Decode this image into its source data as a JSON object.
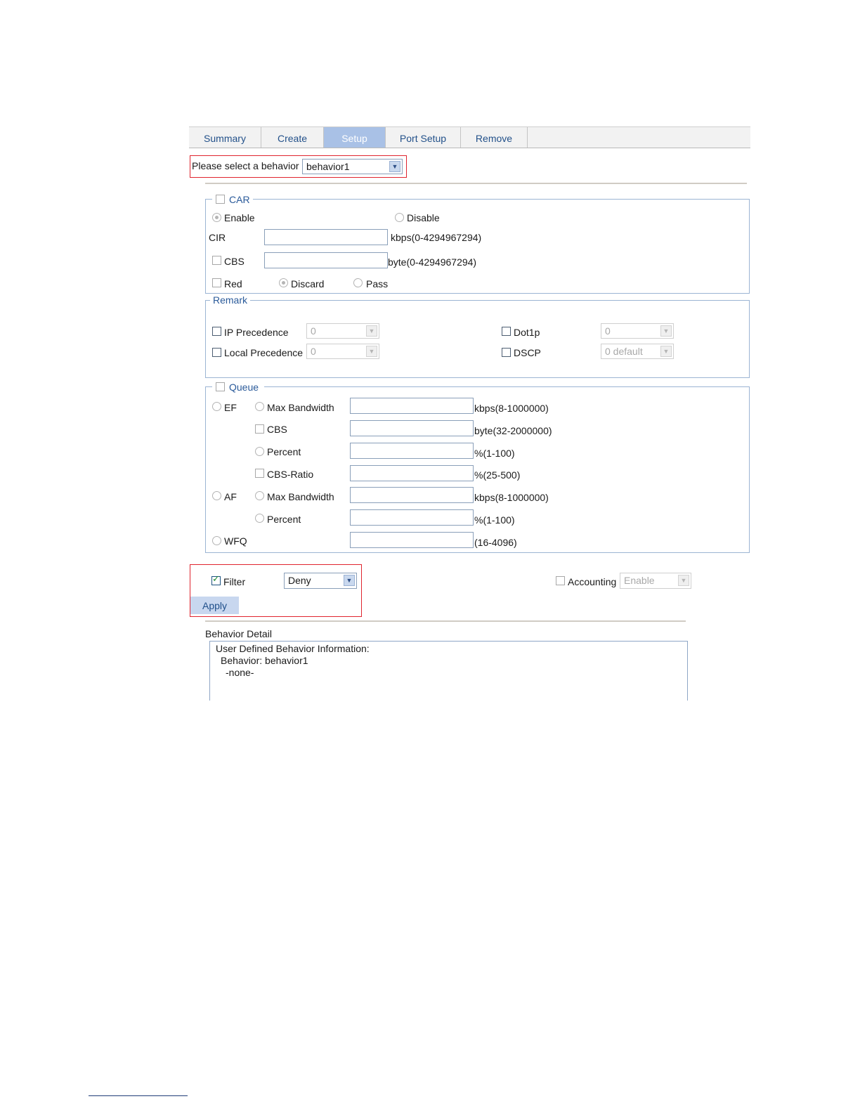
{
  "tabs": [
    {
      "label": "Summary"
    },
    {
      "label": "Create"
    },
    {
      "label": "Setup"
    },
    {
      "label": "Port Setup"
    },
    {
      "label": "Remove"
    }
  ],
  "behavior_select": {
    "label": "Please select a behavior",
    "value": "behavior1"
  },
  "car": {
    "legend": "CAR",
    "enable": "Enable",
    "disable": "Disable",
    "cir_label": "CIR",
    "cir_value": "",
    "cir_range": "kbps(0-4294967294)",
    "cbs_label": "CBS",
    "cbs_value": "",
    "cbs_range": "byte(0-4294967294)",
    "red_label": "Red",
    "discard": "Discard",
    "pass": "Pass"
  },
  "remark": {
    "legend": "Remark",
    "ip_precedence": {
      "label": "IP Precedence",
      "value": "0"
    },
    "local_precedence": {
      "label": "Local Precedence",
      "value": "0"
    },
    "dot1p": {
      "label": "Dot1p",
      "value": "0"
    },
    "dscp": {
      "label": "DSCP",
      "value": "0 default"
    }
  },
  "queue": {
    "legend": "Queue",
    "ef": "EF",
    "af": "AF",
    "wfq": "WFQ",
    "max_bandwidth": "Max Bandwidth",
    "cbs": "CBS",
    "percent": "Percent",
    "cbs_ratio": "CBS-Ratio",
    "ranges": {
      "ef_max_bw": "kbps(8-1000000)",
      "ef_cbs": "byte(32-2000000)",
      "ef_percent": "%(1-100)",
      "ef_cbs_ratio": "%(25-500)",
      "af_max_bw": "kbps(8-1000000)",
      "af_percent": "%(1-100)",
      "wfq": "(16-4096)"
    }
  },
  "filter": {
    "label": "Filter",
    "value": "Deny",
    "checked": true
  },
  "accounting": {
    "label": "Accounting",
    "value": "Enable"
  },
  "apply_label": "Apply",
  "detail": {
    "title": "Behavior Detail",
    "lines": [
      "User Defined Behavior Information:",
      "Behavior: behavior1",
      "-none-"
    ]
  }
}
